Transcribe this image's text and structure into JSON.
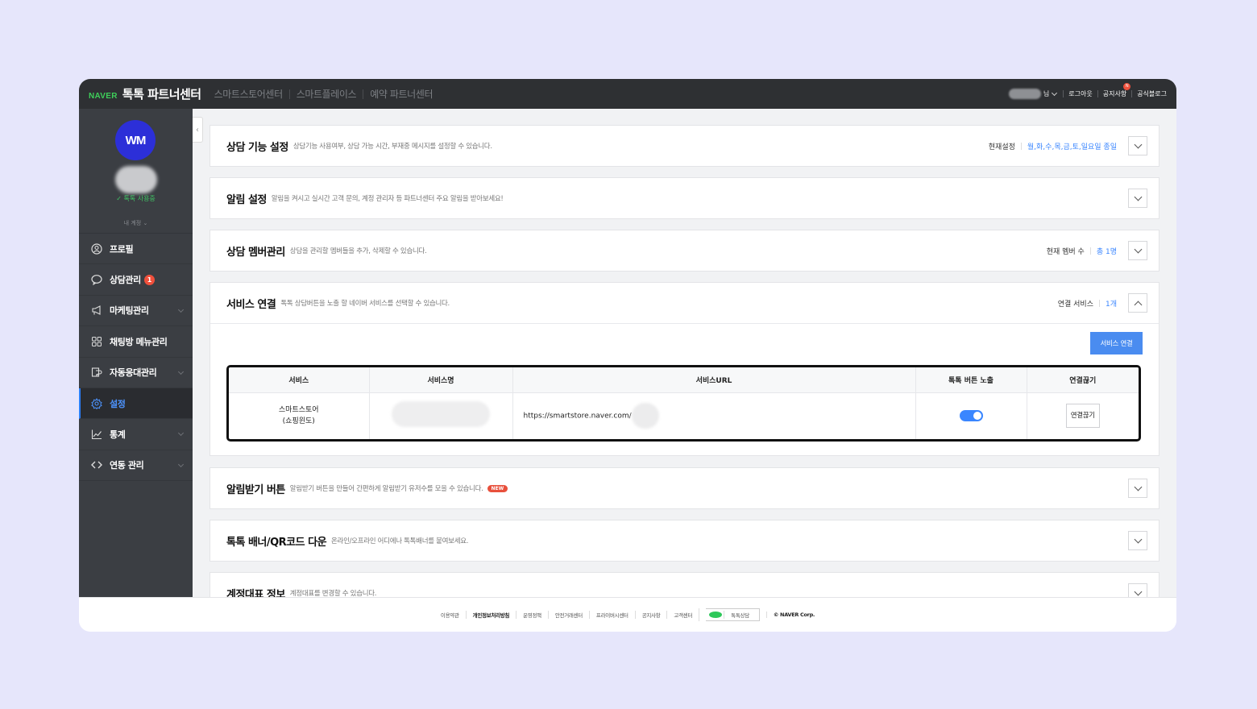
{
  "header": {
    "naver": "NAVER",
    "title": "톡톡 파트너센터",
    "nav": [
      "스마트스토어센터",
      "스마트플레이스",
      "예약 파트너센터"
    ],
    "user_suffix": "님",
    "logout": "로그아웃",
    "notice": "공지사항",
    "notice_badge": "N",
    "blog": "공식블로그"
  },
  "sidebar": {
    "logo_text": "WM",
    "status": "톡톡 사용중",
    "my_account": "내 계정",
    "items": [
      {
        "label": "프로필",
        "icon": "user-icon"
      },
      {
        "label": "상담관리",
        "icon": "chat-icon",
        "badge": "1"
      },
      {
        "label": "마케팅관리",
        "icon": "megaphone-icon"
      },
      {
        "label": "채팅방 메뉴관리",
        "icon": "grid-icon"
      },
      {
        "label": "자동응대관리",
        "icon": "robot-icon"
      },
      {
        "label": "설정",
        "icon": "gear-icon"
      },
      {
        "label": "통계",
        "icon": "chart-icon"
      },
      {
        "label": "연동 관리",
        "icon": "code-icon"
      }
    ]
  },
  "panels": {
    "consult": {
      "title": "상담 기능 설정",
      "desc": "상담기능 사용여부, 상담 가능 시간, 부재중 메시지를 설정할 수 있습니다.",
      "right_label": "현재설정",
      "right_value": "월,화,수,목,금,토,일요일 종일"
    },
    "alarm": {
      "title": "알림 설정",
      "desc": "알림을 켜시고 실시간 고객 문의, 계정 관리자 등 파트너센터 주요 알림을 받아보세요!"
    },
    "member": {
      "title": "상담 멤버관리",
      "desc": "상담을 관리할 멤버들을 추가, 삭제할 수 있습니다.",
      "right_label": "현재 멤버 수",
      "right_value": "총 1명"
    },
    "service": {
      "title": "서비스 연결",
      "desc": "톡톡 상담버튼을 노출 할 네이버 서비스를 선택할 수 있습니다.",
      "right_label": "연결 서비스",
      "right_value": "1개",
      "connect_button": "서비스 연결",
      "columns": [
        "서비스",
        "서비스명",
        "서비스URL",
        "톡톡 버튼 노출",
        "연결끊기"
      ],
      "row": {
        "service_line1": "스마트스토어",
        "service_line2": "(쇼핑윈도)",
        "url": "https://smartstore.naver.com/",
        "exposed": true,
        "disconnect": "연결끊기"
      }
    },
    "subscribe": {
      "title": "알림받기 버튼",
      "desc": "알림받기 버튼을 만들어 간편하게 알림받기 유저수를 모을 수 있습니다.",
      "new_badge": "NEW"
    },
    "banner": {
      "title": "톡톡 배너/QR코드 다운",
      "desc": "온라인/오프라인 어디에나 톡톡배너를 붙여보세요."
    },
    "rep": {
      "title": "계정대표 정보",
      "desc": "계정대표를 변경할 수 있습니다."
    }
  },
  "footer": {
    "links": [
      "이용약관",
      "개인정보처리방침",
      "운영정책",
      "안전거래센터",
      "프라이버시센터",
      "공지사항",
      "고객센터"
    ],
    "talk": "톡톡상담",
    "copyright": "© NAVER Corp."
  },
  "colors": {
    "accent": "#3a86ff",
    "sidebar": "#3b3e43",
    "topbar": "#2e3033",
    "background": "#e6e6fb"
  }
}
